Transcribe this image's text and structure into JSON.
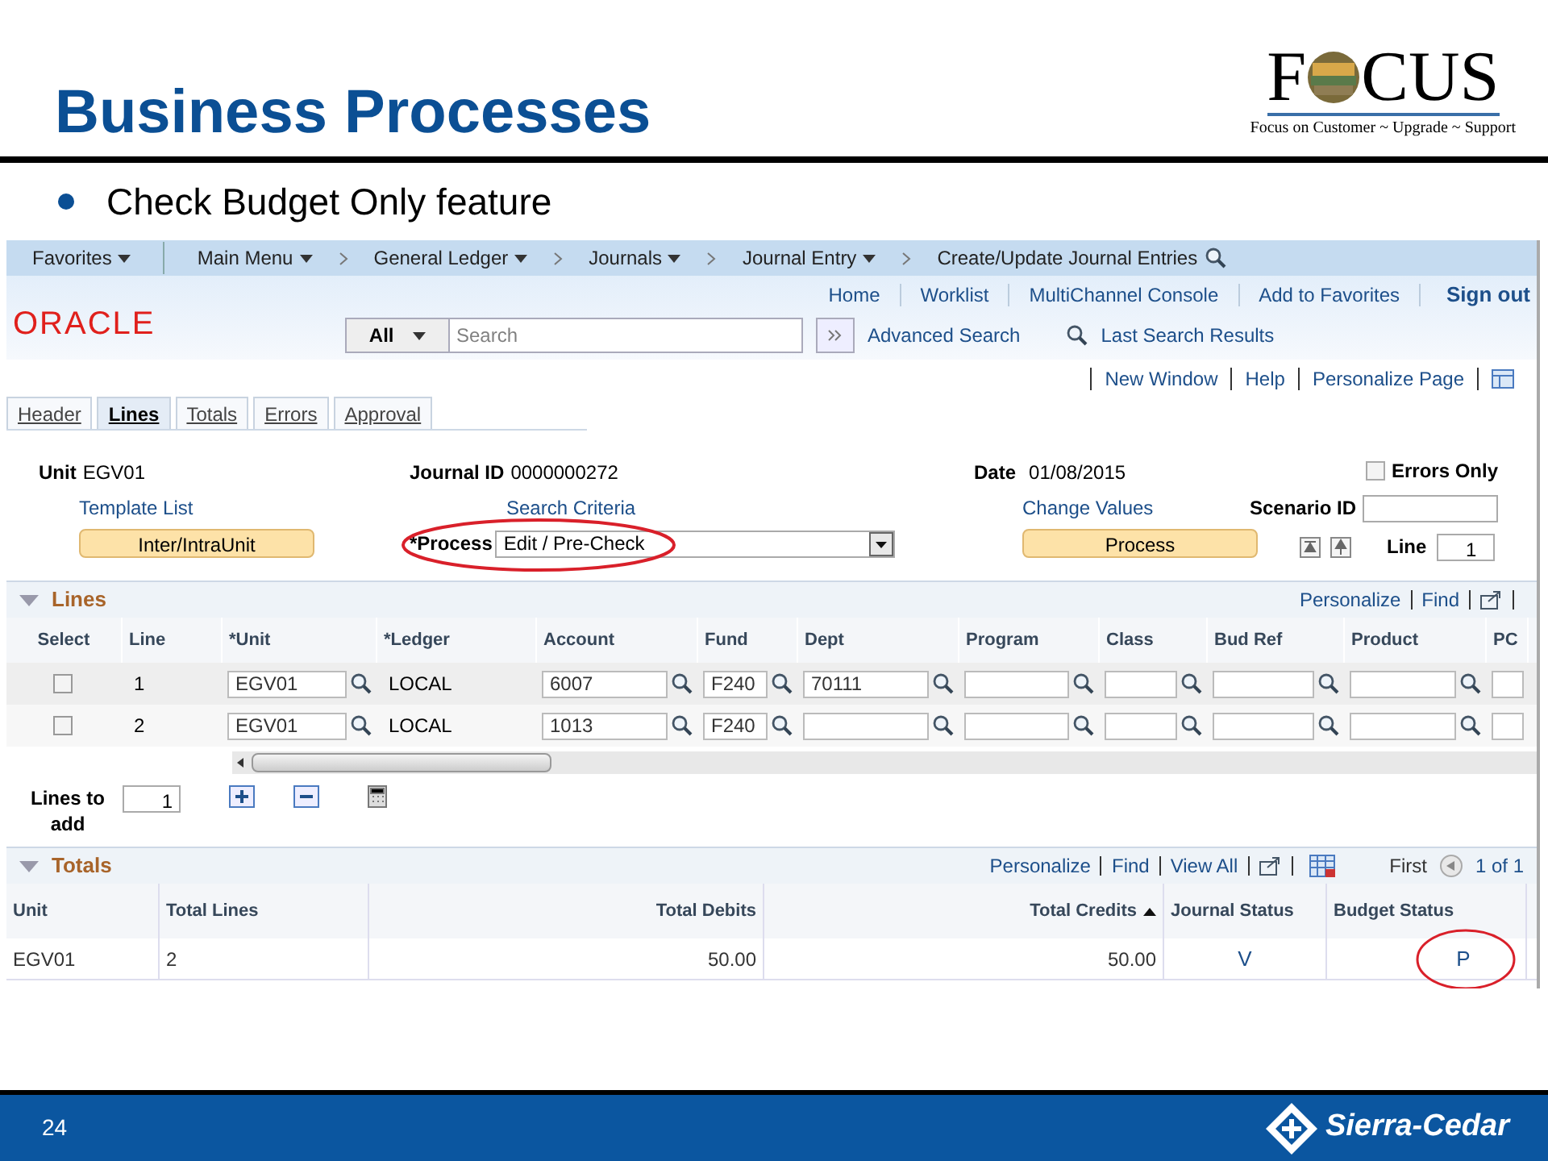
{
  "slide": {
    "title": "Business Processes",
    "bullet": "Check Budget Only feature",
    "logo_parts": [
      "F",
      "CUS"
    ],
    "logo_tagline": "Focus on Customer ~ Upgrade ~ Support",
    "page_number": "24",
    "footer_brand": "Sierra-Cedar"
  },
  "nav": [
    {
      "label": "Favorites",
      "dropdown": true
    },
    {
      "label": "Main Menu",
      "dropdown": true
    },
    {
      "label": "General Ledger",
      "dropdown": true
    },
    {
      "label": "Journals",
      "dropdown": true
    },
    {
      "label": "Journal Entry",
      "dropdown": true
    },
    {
      "label": "Create/Update Journal Entries",
      "dropdown": false
    }
  ],
  "header": {
    "brand": "ORACLE",
    "links": [
      "Home",
      "Worklist",
      "MultiChannel Console",
      "Add to Favorites"
    ],
    "sign_out": "Sign out",
    "search_scope": "All",
    "search_placeholder": "Search",
    "advanced_search": "Advanced Search",
    "last_search": "Last Search Results"
  },
  "page_links": [
    "New Window",
    "Help",
    "Personalize Page"
  ],
  "tabs": [
    {
      "label": "Header",
      "selected": false
    },
    {
      "label": "Lines",
      "selected": true
    },
    {
      "label": "Totals",
      "selected": false
    },
    {
      "label": "Errors",
      "selected": false
    },
    {
      "label": "Approval",
      "selected": false
    }
  ],
  "form": {
    "unit_label": "Unit",
    "unit": "EGV01",
    "journal_id_label": "Journal ID",
    "journal_id": "0000000272",
    "date_label": "Date",
    "date": "01/08/2015",
    "errors_only": {
      "label": "Errors Only",
      "checked": false
    },
    "template_list": "Template List",
    "search_criteria": "Search Criteria",
    "change_values": "Change Values",
    "scenario_label": "Scenario ID",
    "interunit_button": "Inter/IntraUnit",
    "process_label": "*Process",
    "process_value": "Edit / Pre-Check",
    "process_button": "Process",
    "line_label": "Line",
    "line_value": "1"
  },
  "lines": {
    "title": "Lines",
    "toolbar": [
      "Personalize",
      "Find"
    ],
    "columns": [
      {
        "label": "Select",
        "kind": "checkbox"
      },
      {
        "label": "Line",
        "kind": "text"
      },
      {
        "label": "*Unit",
        "kind": "lookup"
      },
      {
        "label": "*Ledger",
        "kind": "text"
      },
      {
        "label": "Account",
        "kind": "lookup"
      },
      {
        "label": "Fund",
        "kind": "lookup"
      },
      {
        "label": "Dept",
        "kind": "lookup"
      },
      {
        "label": "Program",
        "kind": "lookup"
      },
      {
        "label": "Class",
        "kind": "lookup"
      },
      {
        "label": "Bud Ref",
        "kind": "lookup"
      },
      {
        "label": "Product",
        "kind": "lookup"
      },
      {
        "label": "PC",
        "kind": "input"
      }
    ],
    "rows": [
      {
        "selected": false,
        "line": "1",
        "unit": "EGV01",
        "ledger": "LOCAL",
        "account": "6007",
        "fund": "F240",
        "dept": "70111"
      },
      {
        "selected": false,
        "line": "2",
        "unit": "EGV01",
        "ledger": "LOCAL",
        "account": "1013",
        "fund": "F240"
      }
    ],
    "lines_to_add_label": "Lines to add",
    "lines_to_add": "1"
  },
  "totals": {
    "title": "Totals",
    "toolbar": [
      "Personalize",
      "Find",
      "View All"
    ],
    "first": "First",
    "range": "1 of 1",
    "columns": [
      "Unit",
      "Total Lines",
      "Total Debits",
      "Total Credits",
      "Journal Status",
      "Budget Status"
    ],
    "rows": [
      [
        "EGV01",
        "2",
        "50.00",
        "50.00",
        "V",
        "P"
      ]
    ]
  }
}
